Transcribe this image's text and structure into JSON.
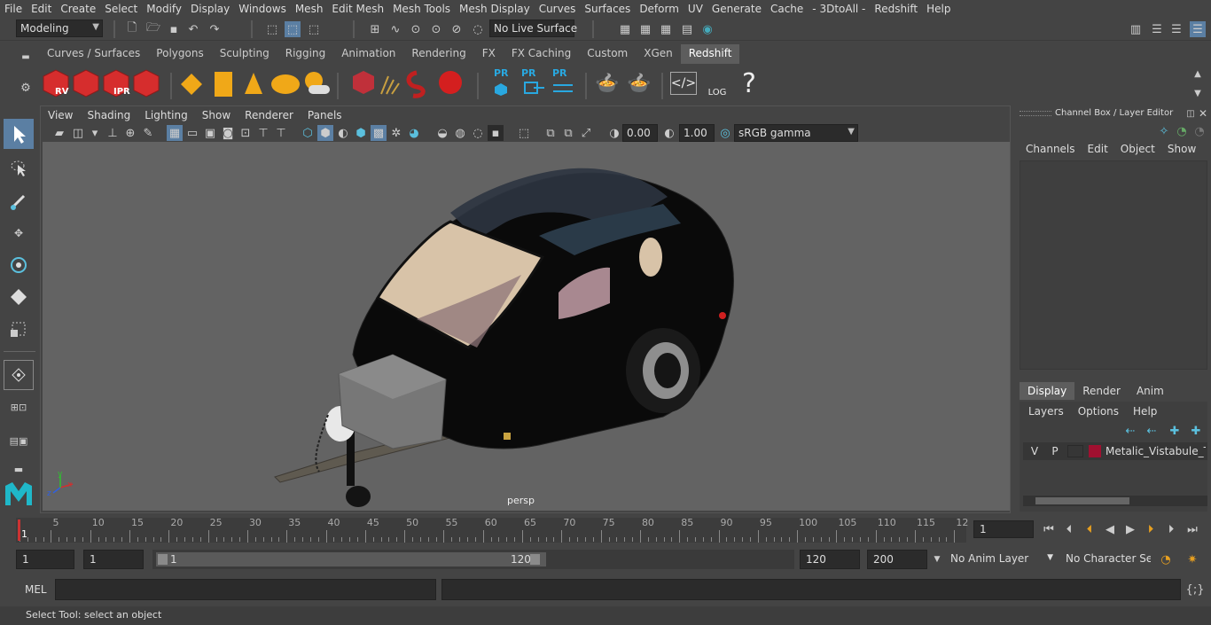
{
  "menu": [
    "File",
    "Edit",
    "Create",
    "Select",
    "Modify",
    "Display",
    "Windows",
    "Mesh",
    "Edit Mesh",
    "Mesh Tools",
    "Mesh Display",
    "Curves",
    "Surfaces",
    "Deform",
    "UV",
    "Generate",
    "Cache",
    "- 3DtoAll -",
    "Redshift",
    "Help"
  ],
  "status": {
    "mode": "Modeling",
    "live_surface": "No Live Surface"
  },
  "shelf_tabs": [
    "Curves / Surfaces",
    "Polygons",
    "Sculpting",
    "Rigging",
    "Animation",
    "Rendering",
    "FX",
    "FX Caching",
    "Custom",
    "XGen",
    "Redshift"
  ],
  "active_shelf_tab": "Redshift",
  "shelf_labels": {
    "rv": "RV",
    "ipr": "IPR",
    "pr1": "PR",
    "pr2": "PR",
    "pr3": "PR",
    "log": "LOG",
    "help": "?"
  },
  "panel_menu": [
    "View",
    "Shading",
    "Lighting",
    "Show",
    "Renderer",
    "Panels"
  ],
  "panel_toolbar": {
    "exposure": "0.00",
    "gamma": "1.00",
    "colorspace": "sRGB gamma"
  },
  "viewport": {
    "camera_label": "persp",
    "axis_x": "x",
    "axis_y": "y",
    "axis_z": "z"
  },
  "channel_box": {
    "title": "Channel Box / Layer Editor",
    "menu": [
      "Channels",
      "Edit",
      "Object",
      "Show"
    ]
  },
  "layer_editor": {
    "tabs": [
      "Display",
      "Render",
      "Anim"
    ],
    "active_tab": "Display",
    "menu": [
      "Layers",
      "Options",
      "Help"
    ],
    "layer": {
      "v": "V",
      "p": "P",
      "name": "Metalic_Vistabule_Tea",
      "color": "#a01030"
    }
  },
  "timeline": {
    "ticks": [
      "5",
      "10",
      "15",
      "20",
      "25",
      "30",
      "35",
      "40",
      "45",
      "50",
      "55",
      "60",
      "65",
      "70",
      "75",
      "80",
      "85",
      "90",
      "95",
      "100",
      "105",
      "110",
      "115",
      "12"
    ],
    "start_label": "1",
    "current_frame": "1"
  },
  "range": {
    "start": "1",
    "anim_start": "1",
    "slider_start": "1",
    "slider_end": "120",
    "end": "120",
    "anim_end": "200",
    "anim_layer": "No Anim Layer",
    "character_set": "No Character Set"
  },
  "command": {
    "lang": "MEL"
  },
  "help_line": "Select Tool: select an object"
}
